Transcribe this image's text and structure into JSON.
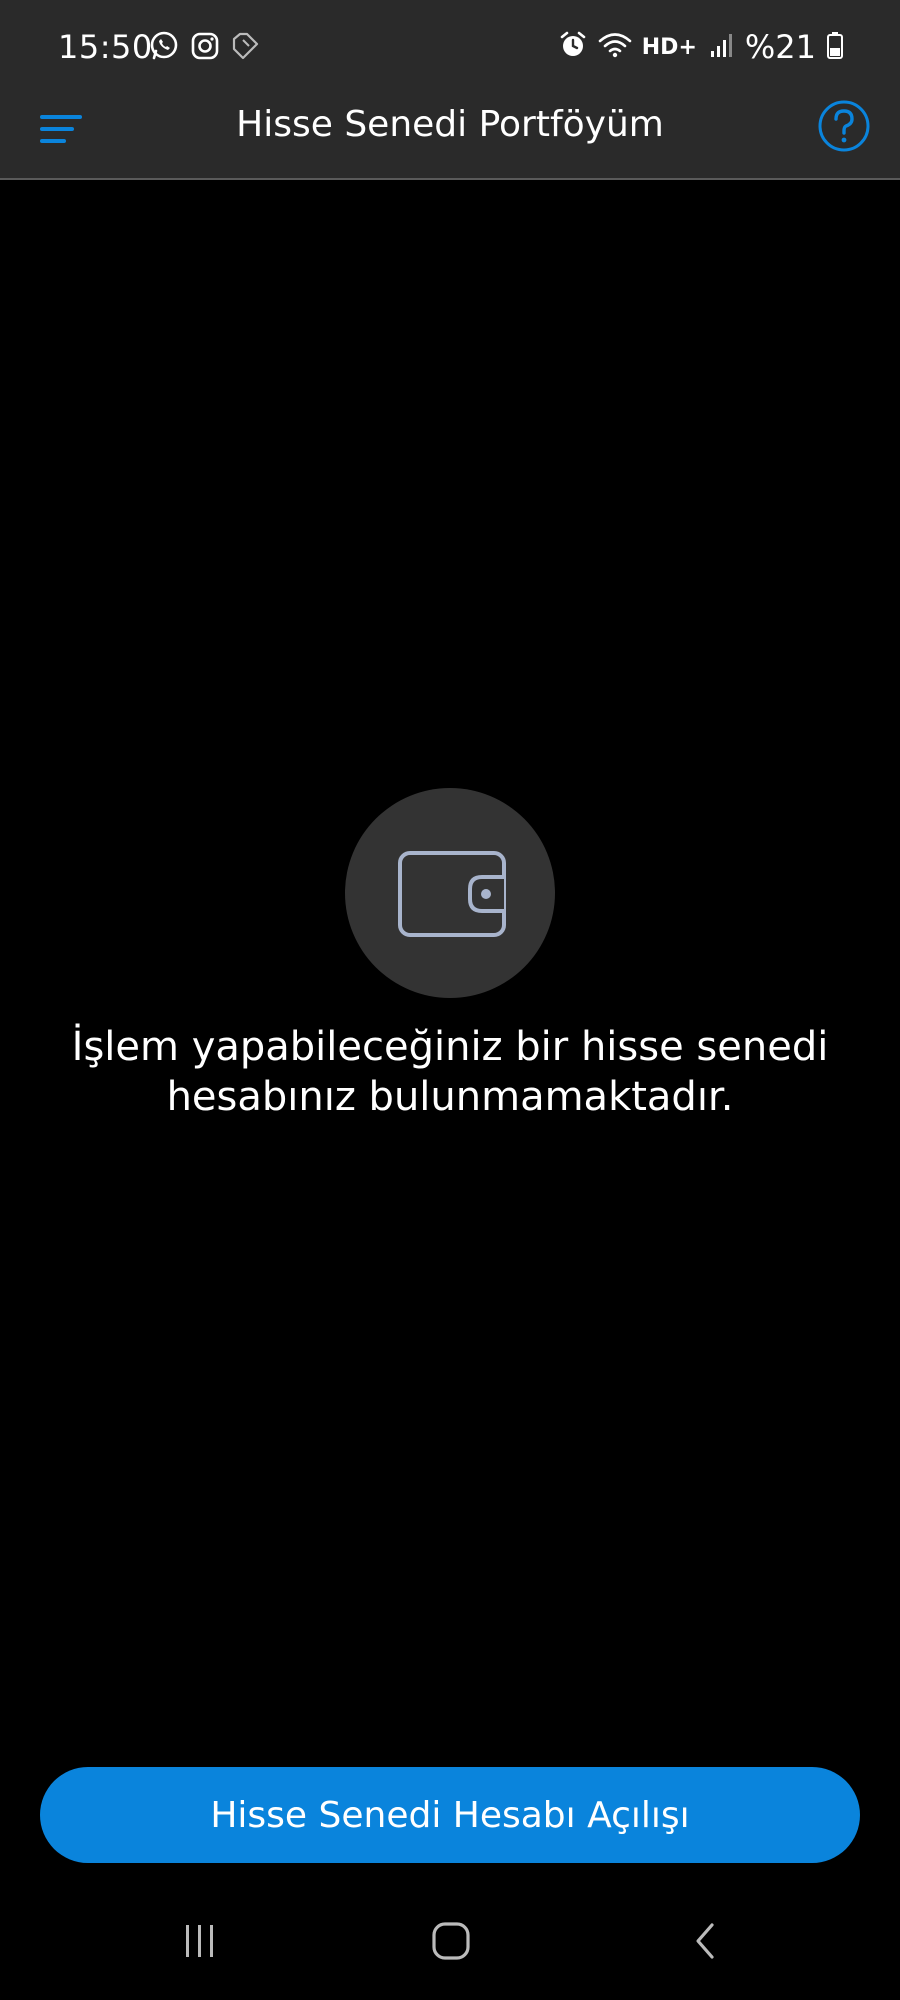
{
  "status_bar": {
    "time": "15:50",
    "battery": "%21",
    "network": "HD+",
    "left_icons": [
      "whatsapp-icon",
      "instagram-icon",
      "tag-icon"
    ],
    "right_icons": [
      "alarm-icon",
      "wifi-icon",
      "signal-icon",
      "battery-icon"
    ]
  },
  "header": {
    "title": "Hisse Senedi Portföyüm",
    "menu_icon": "hamburger-menu-icon",
    "help_icon": "help-circle-icon",
    "accent_color": "#0a84dc"
  },
  "empty_state": {
    "icon": "wallet-icon",
    "message_line1": "İşlem yapabileceğiniz bir hisse senedi",
    "message_line2": "hesabınız bulunmamaktadır."
  },
  "cta": {
    "label": "Hisse Senedi Hesabı Açılışı",
    "color": "#0a84dc"
  },
  "nav": {
    "icons": [
      "recent-apps-icon",
      "home-icon",
      "back-icon"
    ]
  }
}
